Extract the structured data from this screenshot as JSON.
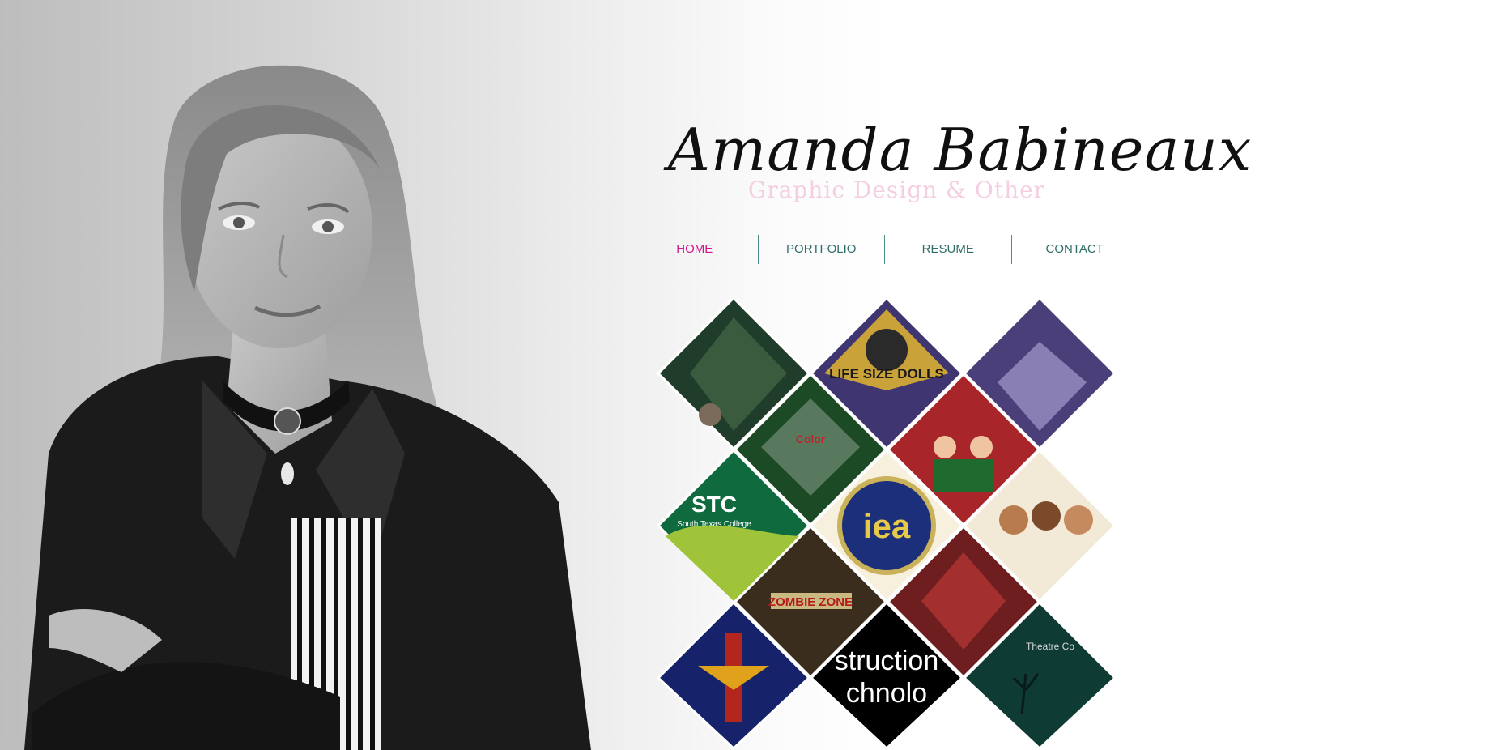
{
  "header": {
    "name": "Amanda Babineaux",
    "tagline": "Graphic Design & Other"
  },
  "nav": {
    "items": [
      {
        "label": "HOME",
        "active": true
      },
      {
        "label": "PORTFOLIO",
        "active": false
      },
      {
        "label": "RESUME",
        "active": false
      },
      {
        "label": "CONTACT",
        "active": false
      }
    ]
  },
  "colors": {
    "accent": "#d3158d",
    "nav_text": "#2f6e68",
    "divider": "#4c8d86",
    "tagline": "#f4cfe2"
  },
  "gallery": {
    "tiles": [
      {
        "name": "gallery-tile-forest-scene",
        "text": ""
      },
      {
        "name": "gallery-tile-portrait-poster",
        "text": ""
      },
      {
        "name": "gallery-tile-bedroom-scene",
        "text": ""
      },
      {
        "name": "gallery-tile-life-size-dolls",
        "text": "LIFE SIZE DOLLS"
      },
      {
        "name": "gallery-tile-el-color",
        "text": "Color"
      },
      {
        "name": "gallery-tile-holiday",
        "text": ""
      },
      {
        "name": "gallery-tile-stc",
        "text": "STC"
      },
      {
        "name": "gallery-tile-stc-subtitle",
        "text": "South Texas College"
      },
      {
        "name": "gallery-tile-iea",
        "text": "iea"
      },
      {
        "name": "gallery-tile-caricatures",
        "text": ""
      },
      {
        "name": "gallery-tile-zombie-zone",
        "text": "ZOMBIE ZONE"
      },
      {
        "name": "gallery-tile-totem",
        "text": ""
      },
      {
        "name": "gallery-tile-instruction",
        "text": "struction"
      },
      {
        "name": "gallery-tile-instruction-2",
        "text": "chnolo"
      },
      {
        "name": "gallery-tile-theatre",
        "text": "Theatre Co"
      }
    ]
  }
}
